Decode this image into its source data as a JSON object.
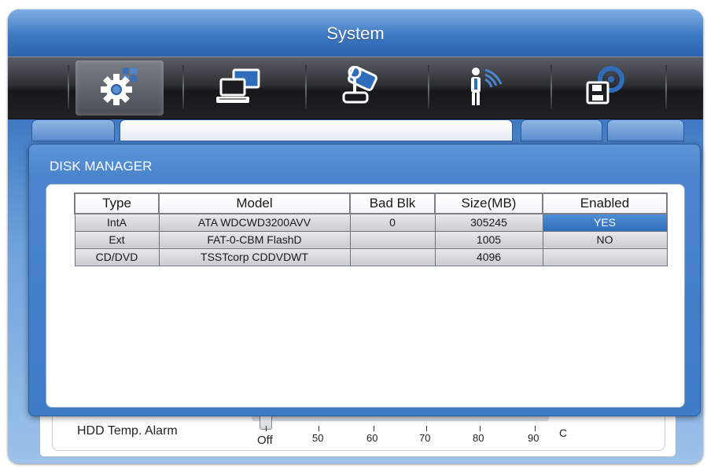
{
  "window": {
    "title": "System"
  },
  "toolbar": {
    "icons": [
      "system-settings-icon",
      "network-computer-icon",
      "ptz-joystick-icon",
      "event-sensor-icon",
      "storage-disk-icon"
    ]
  },
  "hdd_temp": {
    "label": "HDD Temp. Alarm",
    "ticks": [
      "Off",
      "50",
      "60",
      "70",
      "80",
      "90"
    ],
    "unit": "C",
    "value": "Off"
  },
  "dialog": {
    "title": "DISK MANAGER",
    "table": {
      "headers": [
        "Type",
        "Model",
        "Bad Blk",
        "Size(MB)",
        "Enabled"
      ],
      "rows": [
        [
          "IntA",
          "ATA WDCWD3200AVV",
          "0",
          "305245",
          "YES"
        ],
        [
          "Ext",
          "FAT-0-CBM FlashD",
          "",
          "1005",
          "NO"
        ],
        [
          "CD/DVD",
          "TSSTcorp CDDVDWT",
          "",
          "4096",
          ""
        ]
      ]
    }
  },
  "colors": {
    "window_blue": "#3f7cc8",
    "selected_cell": "#2f6dbb",
    "toolbar_dark": "#1f2226"
  }
}
